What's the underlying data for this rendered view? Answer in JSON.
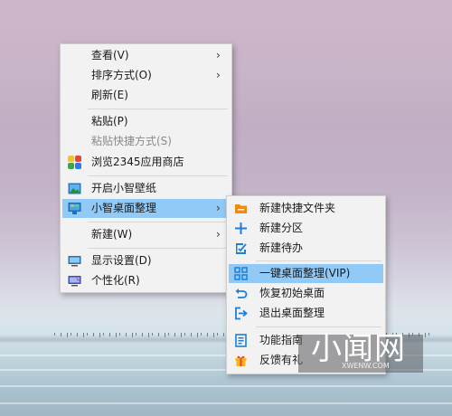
{
  "context_menu": {
    "items": [
      {
        "label": "查看(V)",
        "submenu": true
      },
      {
        "label": "排序方式(O)",
        "submenu": true
      },
      {
        "label": "刷新(E)"
      },
      {
        "label": "粘贴(P)"
      },
      {
        "label": "粘贴快捷方式(S)",
        "disabled": true
      },
      {
        "label": "浏览2345应用商店",
        "icon": "colorful-grid-icon"
      },
      {
        "label": "开启小智壁纸",
        "icon": "wallpaper-icon"
      },
      {
        "label": "小智桌面整理",
        "icon": "desktop-organize-icon",
        "submenu": true,
        "highlighted": true
      },
      {
        "label": "新建(W)",
        "submenu": true
      },
      {
        "label": "显示设置(D)",
        "icon": "display-icon"
      },
      {
        "label": "个性化(R)",
        "icon": "personalize-icon"
      }
    ],
    "arrow_glyph": "›"
  },
  "submenu": {
    "items": [
      {
        "label": "新建快捷文件夹",
        "icon": "folder-icon"
      },
      {
        "label": "新建分区",
        "icon": "plus-icon"
      },
      {
        "label": "新建待办",
        "icon": "todo-icon"
      },
      {
        "label": "一键桌面整理(VIP)",
        "icon": "grid-icon",
        "highlighted": true
      },
      {
        "label": "恢复初始桌面",
        "icon": "undo-icon"
      },
      {
        "label": "退出桌面整理",
        "icon": "exit-icon"
      },
      {
        "label": "功能指南",
        "icon": "guide-icon"
      },
      {
        "label": "反馈有礼",
        "icon": "gift-icon"
      }
    ]
  },
  "watermark": {
    "text": "小闻网",
    "subtext": "XWENW.COM"
  },
  "colors": {
    "menu_bg": "#f2f2f2",
    "highlight": "#91c9f7",
    "icon_blue": "#1d7fd8",
    "icon_orange": "#f08a17"
  }
}
